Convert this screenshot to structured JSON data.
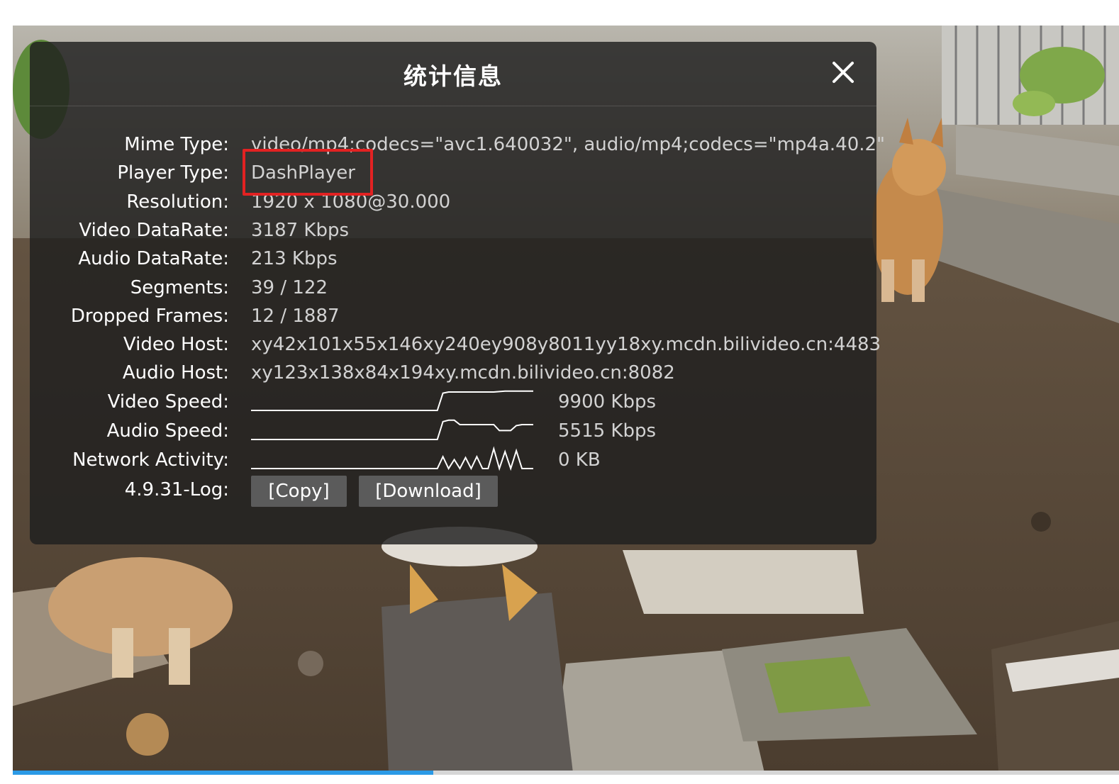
{
  "panel": {
    "title": "统计信息",
    "rows": [
      {
        "label": "Mime Type:",
        "value": "video/mp4;codecs=\"avc1.640032\", audio/mp4;codecs=\"mp4a.40.2\""
      },
      {
        "label": "Player Type:",
        "value": "DashPlayer"
      },
      {
        "label": "Resolution:",
        "value": "1920 x 1080@30.000"
      },
      {
        "label": "Video DataRate:",
        "value": "3187 Kbps"
      },
      {
        "label": "Audio DataRate:",
        "value": "213 Kbps"
      },
      {
        "label": "Segments:",
        "value": "39 / 122"
      },
      {
        "label": "Dropped Frames:",
        "value": "12 / 1887"
      },
      {
        "label": "Video Host:",
        "value": "xy42x101x55x146xy240ey908y8011yy18xy.mcdn.bilivideo.cn:4483"
      },
      {
        "label": "Audio Host:",
        "value": "xy123x138x84x194xy.mcdn.bilivideo.cn:8082"
      }
    ],
    "video_speed": {
      "label": "Video Speed:",
      "value": "9900 Kbps"
    },
    "audio_speed": {
      "label": "Audio Speed:",
      "value": "5515 Kbps"
    },
    "network_activity": {
      "label": "Network Activity:",
      "value": "0 KB"
    },
    "log": {
      "label": "4.9.31-Log:",
      "copy_label": "[Copy]",
      "download_label": "[Download]"
    }
  },
  "sparklines": {
    "video_speed": [
      0,
      0,
      0,
      0,
      0,
      0,
      0,
      0,
      0,
      0,
      0,
      0,
      0,
      0,
      0,
      0,
      0,
      0,
      0,
      0,
      0,
      0,
      0,
      0,
      0,
      0,
      0,
      0,
      0,
      0,
      0,
      0,
      0,
      0,
      0.87,
      0.93,
      0.93,
      0.93,
      0.93,
      0.93,
      0.93,
      0.93,
      0.93,
      0.93,
      0.95,
      0.97,
      0.97,
      0.97,
      0.97,
      0.97,
      0.97
    ],
    "audio_speed": [
      0,
      0,
      0,
      0,
      0,
      0,
      0,
      0,
      0,
      0,
      0,
      0,
      0,
      0,
      0,
      0,
      0,
      0,
      0,
      0,
      0,
      0,
      0,
      0,
      0,
      0,
      0,
      0,
      0,
      0,
      0,
      0,
      0,
      0,
      0.9,
      0.97,
      0.97,
      0.75,
      0.75,
      0.75,
      0.75,
      0.75,
      0.75,
      0.75,
      0.45,
      0.45,
      0.45,
      0.7,
      0.75,
      0.75,
      0.75
    ],
    "network_activity": [
      0,
      0,
      0,
      0,
      0,
      0,
      0,
      0,
      0,
      0,
      0,
      0,
      0,
      0,
      0,
      0,
      0,
      0,
      0,
      0,
      0,
      0,
      0,
      0,
      0,
      0,
      0,
      0,
      0,
      0,
      0,
      0,
      0,
      0,
      0.6,
      0,
      0.45,
      0,
      0.55,
      0,
      0.6,
      0,
      0,
      1,
      0,
      0.85,
      0,
      0.9,
      0,
      0,
      0
    ]
  },
  "video": {
    "progress": 0.38
  },
  "colors": {
    "annotation": "#e32222",
    "progress": "#2b9ae6",
    "panel_bg": "rgba(30,30,30,0.82)"
  }
}
